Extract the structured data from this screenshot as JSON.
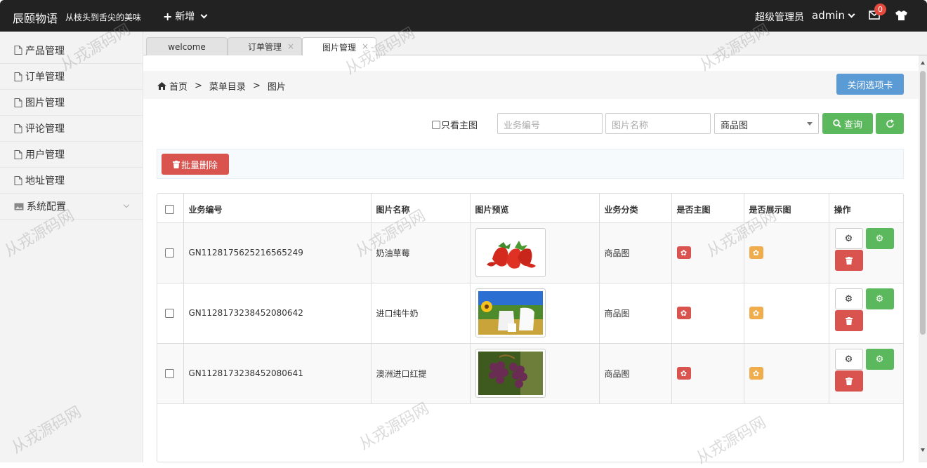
{
  "topbar": {
    "logo": "辰颐物语",
    "slogan": "从枝头到舌尖的美味",
    "add_label": "新增",
    "role": "超级管理员",
    "user": "admin",
    "mail_count": "0"
  },
  "sidebar": {
    "items": [
      {
        "label": "产品管理"
      },
      {
        "label": "订单管理"
      },
      {
        "label": "图片管理"
      },
      {
        "label": "评论管理"
      },
      {
        "label": "用户管理"
      },
      {
        "label": "地址管理"
      },
      {
        "label": "系统配置"
      }
    ]
  },
  "tabs": [
    {
      "label": "welcome"
    },
    {
      "label": "订单管理"
    },
    {
      "label": "图片管理"
    }
  ],
  "breadcrumb": {
    "home": "首页",
    "sep": ">",
    "level1": "菜单目录",
    "level2": "图片"
  },
  "close_tabs_label": "关闭选项卡",
  "filters": {
    "main_only_label": "只看主图",
    "code_placeholder": "业务编号",
    "name_placeholder": "图片名称",
    "category_selected": "商品图",
    "query_label": "查询"
  },
  "batch_delete_label": "批量删除",
  "table": {
    "headers": [
      "业务编号",
      "图片名称",
      "图片预览",
      "业务分类",
      "是否主图",
      "是否展示图",
      "操作"
    ],
    "rows": [
      {
        "code": "GN1128175625216565249",
        "name": "奶油草莓",
        "category": "商品图",
        "image": "strawberry"
      },
      {
        "code": "GN1128173238452080642",
        "name": "进口纯牛奶",
        "category": "商品图",
        "image": "milk"
      },
      {
        "code": "GN1128173238452080641",
        "name": "澳洲进口红提",
        "category": "商品图",
        "image": "grapes"
      }
    ]
  },
  "watermark": "从戎源码网",
  "colors": {
    "topbar": "#222222",
    "primary": "#5b9bd5",
    "success": "#5cb85c",
    "danger": "#d9534f",
    "warning": "#f0ad4e"
  }
}
